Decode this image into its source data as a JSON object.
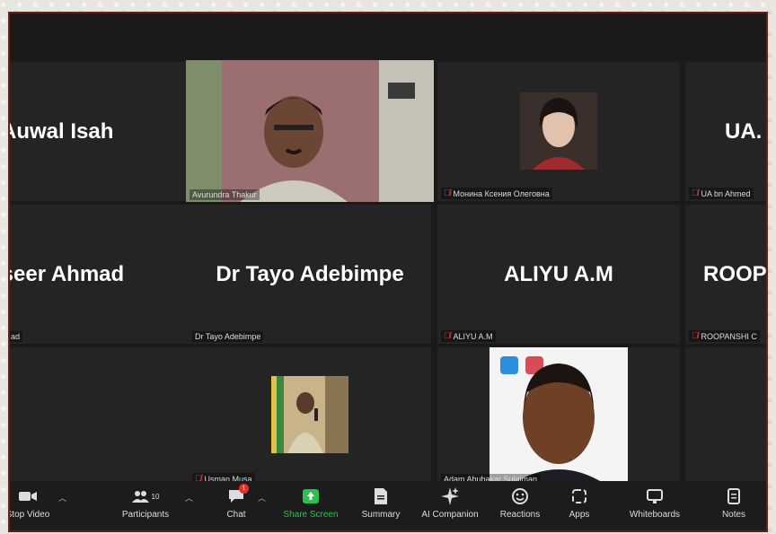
{
  "tiles": {
    "t1": {
      "big": "Auwal Isah"
    },
    "t2": {
      "cap": "Avurundra Thakur"
    },
    "t3": {
      "cap": "Монина Ксения Олеговна"
    },
    "t4": {
      "big": "UA.",
      "cap": "UA bn Ahmed"
    },
    "t5": {
      "big": "Naseer Ahmad",
      "cap": "ad"
    },
    "t6": {
      "big": "Dr Tayo Adebimpe",
      "cap": "Dr Tayo Adebimpe"
    },
    "t7": {
      "big": "ALIYU A.M",
      "cap": "ALIYU A.M"
    },
    "t8": {
      "big": "ROOP",
      "cap": "ROOPANSHI C"
    },
    "t10": {
      "cap": "Usman Musa"
    },
    "t11": {
      "cap": "Adam Abubakar Sulaiman"
    }
  },
  "toolbar": {
    "stop_video": "Stop Video",
    "participants": "Participants",
    "participants_count": "10",
    "chat": "Chat",
    "chat_badge": "1",
    "share_screen": "Share Screen",
    "summary": "Summary",
    "ai_companion": "AI Companion",
    "reactions": "Reactions",
    "apps": "Apps",
    "whiteboards": "Whiteboards",
    "notes": "Notes"
  },
  "colors": {
    "active_speaker_border": "#c8e36a",
    "share_screen": "#2fbf4f",
    "mute_icon": "#e03a3a",
    "frame_border": "#6b1d17"
  }
}
